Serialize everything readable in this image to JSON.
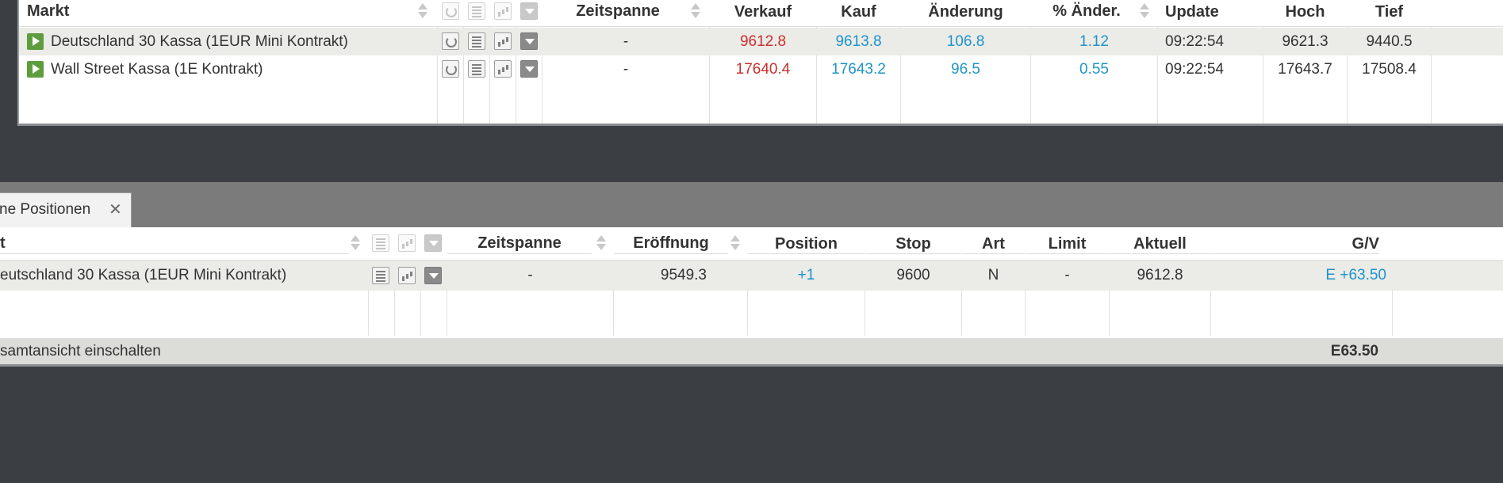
{
  "markets": {
    "columns": {
      "markt": "Markt",
      "zeitspanne": "Zeitspanne",
      "verkauf": "Verkauf",
      "kauf": "Kauf",
      "aenderung": "Änderung",
      "pct": "% Änder.",
      "update": "Update",
      "hoch": "Hoch",
      "tief": "Tief"
    },
    "rows": [
      {
        "name": "Deutschland 30 Kassa (1EUR Mini Kontrakt)",
        "zeitspanne": "-",
        "verkauf": "9612.8",
        "kauf": "9613.8",
        "aenderung": "106.8",
        "pct": "1.12",
        "update": "09:22:54",
        "hoch": "9621.3",
        "tief": "9440.5"
      },
      {
        "name": "Wall Street Kassa (1E Kontrakt)",
        "zeitspanne": "-",
        "verkauf": "17640.4",
        "kauf": "17643.2",
        "aenderung": "96.5",
        "pct": "0.55",
        "update": "09:22:54",
        "hoch": "17643.7",
        "tief": "17508.4"
      }
    ]
  },
  "tab": {
    "label": "ne Positionen",
    "close": "✕"
  },
  "positions": {
    "columns": {
      "markt": "t",
      "zeitspanne": "Zeitspanne",
      "eroeffnung": "Eröffnung",
      "position": "Position",
      "stop": "Stop",
      "art": "Art",
      "limit": "Limit",
      "aktuell": "Aktuell",
      "gv": "G/V"
    },
    "rows": [
      {
        "name": "eutschland 30 Kassa (1EUR Mini Kontrakt)",
        "zeitspanne": "-",
        "eroeffnung": "9549.3",
        "position": "+1",
        "stop": "9600",
        "art": "N",
        "limit": "-",
        "aktuell": "9612.8",
        "gv": "E +63.50"
      }
    ],
    "footer": {
      "label": "samtansicht einschalten",
      "total": "E63.50"
    }
  },
  "colors": {
    "sell": "#c9302c",
    "buy": "#1e94c9",
    "background": "#3b3f44",
    "band": "#7b7b7b"
  }
}
